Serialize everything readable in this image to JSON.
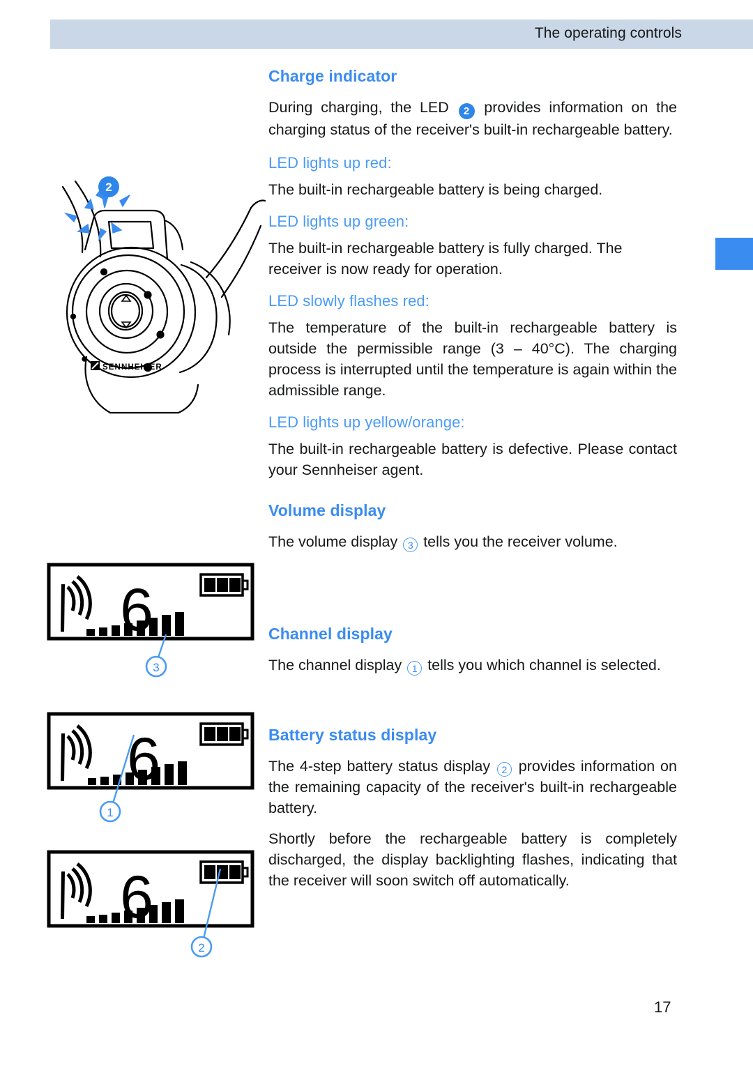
{
  "header": {
    "title": "The operating controls"
  },
  "page": {
    "number": "17"
  },
  "edge_tab": {
    "color": "#3b8cf0"
  },
  "colors": {
    "heading_blue": "#3b8cf0",
    "subheading_blue": "#4a9bf5",
    "badge_fill_blue": "#2f86e8",
    "header_band": "#c9d7e6",
    "body_text": "#16181a"
  },
  "sections": {
    "charge_indicator": {
      "heading": "Charge indicator",
      "intro_a": "During charging, the LED",
      "intro_badge": "2",
      "intro_b": "provides information on the charging status of the receiver's built-in rechargeable battery.",
      "states": [
        {
          "label": "LED lights up red:",
          "text": "The built-in rechargeable battery is being charged."
        },
        {
          "label": "LED lights up green:",
          "text": "The built-in rechargeable battery is fully charged. The receiver is now ready for operation."
        },
        {
          "label": "LED slowly flashes red:",
          "text": "The temperature of the built-in rechargeable battery is outside the permissible range (3 – 40°C). The charging process is interrupted until the temperature is again within the admissible range."
        },
        {
          "label": "LED lights up yellow/orange:",
          "text": "The built-in rechargeable battery is defective. Please contact your Sennheiser agent."
        }
      ]
    },
    "volume_display": {
      "heading": "Volume display",
      "text_a": "The volume display",
      "badge": "3",
      "text_b": "tells you the receiver volume."
    },
    "channel_display": {
      "heading": "Channel display",
      "text_a": "The channel display",
      "badge": "1",
      "text_b": "tells you which channel is selected."
    },
    "battery_status_display": {
      "heading": "Battery status display",
      "text_a": "The 4-step battery status display",
      "badge": "2",
      "text_b": "provides information on the remaining capacity of the receiver's built-in rechargeable battery.",
      "paragraph2": "Shortly before the rechargeable battery is completely discharged, the display backlighting flashes, indicating that the receiver will soon switch off automatically."
    }
  },
  "figures": {
    "receiver": {
      "name": "sennheiser-receiver-illustration",
      "brand_text": "SENNHEISER",
      "callout": "2",
      "callout_style": "filled"
    },
    "lcd_volume": {
      "name": "lcd-volume-display",
      "channel_digit": "6",
      "volume_bars_total": 8,
      "volume_bars_lit": 8,
      "battery_segments_total": 3,
      "battery_segments_filled": 3,
      "antenna_arcs": 3,
      "callout": "3",
      "callout_style": "outline",
      "callout_target": "volume-bars"
    },
    "lcd_channel": {
      "name": "lcd-channel-display",
      "channel_digit": "6",
      "volume_bars_total": 8,
      "volume_bars_lit": 8,
      "battery_segments_total": 3,
      "battery_segments_filled": 3,
      "antenna_arcs": 3,
      "callout": "1",
      "callout_style": "outline",
      "callout_target": "channel-digit"
    },
    "lcd_battery": {
      "name": "lcd-battery-status-display",
      "channel_digit": "6",
      "volume_bars_total": 8,
      "volume_bars_lit": 8,
      "battery_segments_total": 3,
      "battery_segments_filled": 3,
      "antenna_arcs": 3,
      "callout": "2",
      "callout_style": "outline",
      "callout_target": "battery-icon"
    }
  }
}
